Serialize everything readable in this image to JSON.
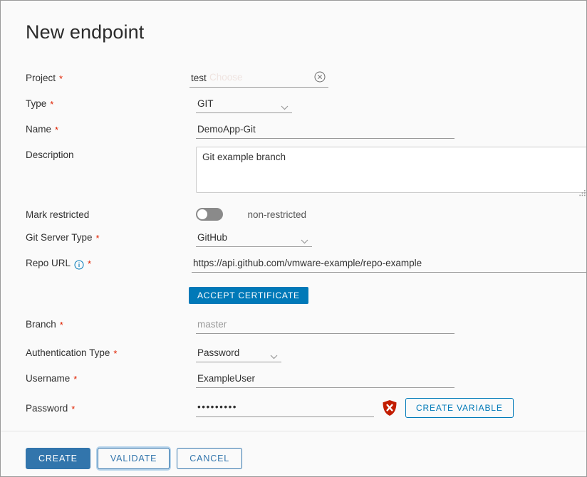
{
  "window": {
    "title": "New endpoint"
  },
  "form": {
    "project": {
      "label": "Project",
      "required": true,
      "value": "test",
      "ghost_value": "Choose",
      "clear_icon": "circle-x-icon"
    },
    "type": {
      "label": "Type",
      "required": true,
      "value": "GIT",
      "options": [
        "GIT"
      ],
      "chevron_icon": "chevron-down-icon"
    },
    "name": {
      "label": "Name",
      "required": true,
      "value": "DemoApp-Git"
    },
    "description": {
      "label": "Description",
      "required": false,
      "value": "Git example branch",
      "resize_grip_icon": "resize-grip-icon"
    },
    "mark_restricted": {
      "label": "Mark restricted",
      "required": false,
      "state_text": "non-restricted",
      "on": false
    },
    "git_server_type": {
      "label": "Git Server Type",
      "required": true,
      "value": "GitHub",
      "options": [
        "GitHub"
      ],
      "chevron_icon": "chevron-down-icon"
    },
    "repo_url": {
      "label": "Repo URL",
      "required": true,
      "info_icon": "info-circle-icon",
      "value": "https://api.github.com/vmware-example/repo-example"
    },
    "accept_certificate": {
      "label": "ACCEPT CERTIFICATE"
    },
    "branch": {
      "label": "Branch",
      "required": true,
      "value": "",
      "placeholder": "master"
    },
    "authentication_type": {
      "label": "Authentication Type",
      "required": true,
      "value": "Password",
      "options": [
        "Password"
      ],
      "chevron_icon": "chevron-down-icon"
    },
    "username": {
      "label": "Username",
      "required": true,
      "value": "ExampleUser"
    },
    "password": {
      "label": "Password",
      "required": true,
      "value": "•••••••••",
      "error_icon": "shield-error-icon",
      "create_variable_label": "CREATE VARIABLE"
    }
  },
  "footer": {
    "create_label": "CREATE",
    "validate_label": "VALIDATE",
    "cancel_label": "CANCEL"
  },
  "colors": {
    "accent_blue": "#0079b8",
    "footer_blue": "#3275ac",
    "required_red": "#e02200",
    "error_red": "#c21d00",
    "label_text": "#313131",
    "muted_text": "#9a9a9a",
    "background": "#fafafa"
  }
}
